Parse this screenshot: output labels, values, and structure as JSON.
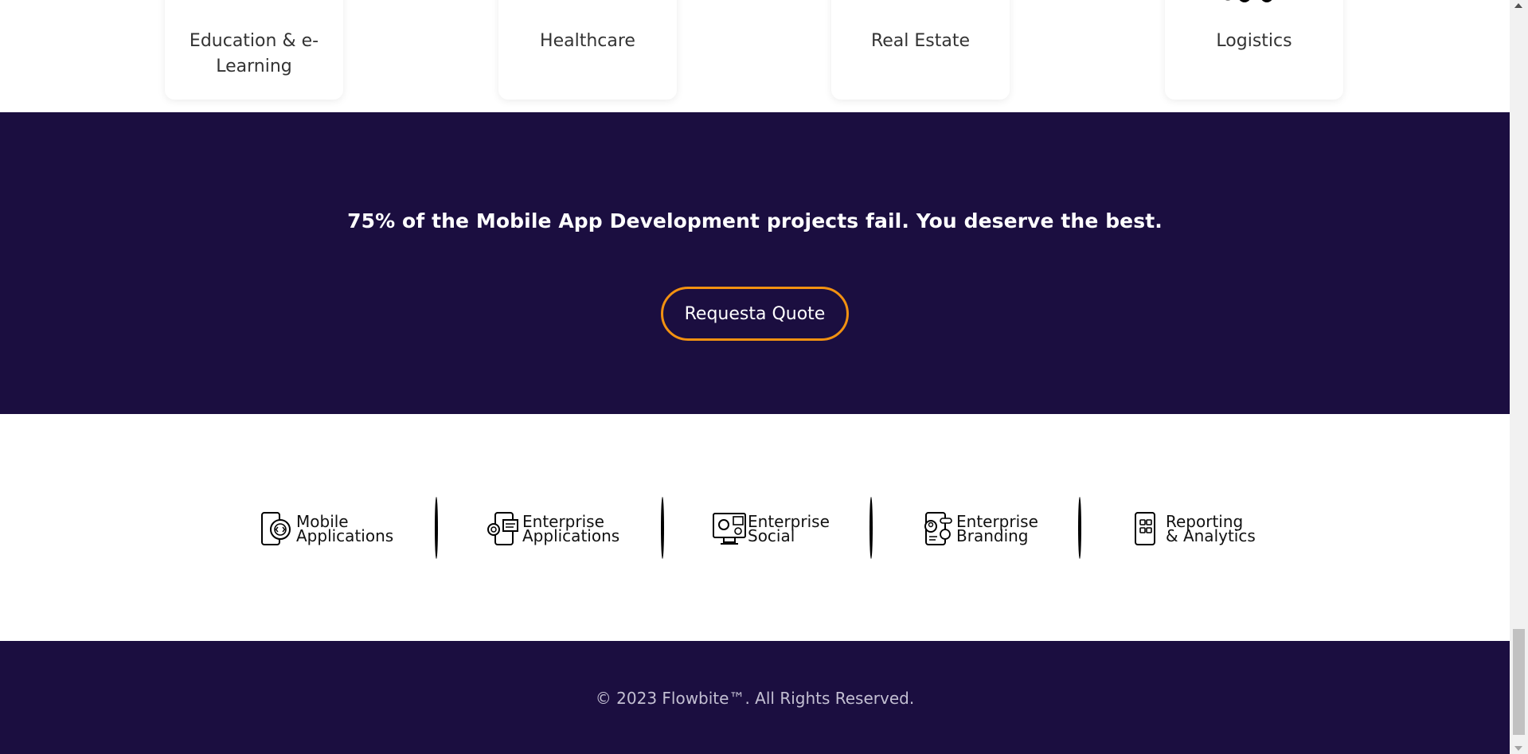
{
  "industries": [
    {
      "label": "Education & e-Learning",
      "icon": "education-icon"
    },
    {
      "label": "Healthcare",
      "icon": "healthcare-icon"
    },
    {
      "label": "Real Estate",
      "icon": "real-estate-icon"
    },
    {
      "label": "Logistics",
      "icon": "logistics-truck-icon"
    }
  ],
  "cta": {
    "heading": "75% of the Mobile App Development projects fail. You deserve the best.",
    "button_label": "Requesta Quote"
  },
  "services": [
    {
      "line1": "Mobile",
      "line2": "Applications",
      "icon": "mobile-code-gear-icon"
    },
    {
      "line1": "Enterprise",
      "line2": "Applications",
      "icon": "enterprise-apps-icon"
    },
    {
      "line1": "Enterprise",
      "line2": "Social",
      "icon": "enterprise-social-icon"
    },
    {
      "line1": "Enterprise",
      "line2": "Branding",
      "icon": "enterprise-branding-icon"
    },
    {
      "line1": "Reporting",
      "line2": "& Analytics",
      "icon": "reporting-analytics-icon"
    }
  ],
  "footer": {
    "copyright": "© 2023 Flowbite™. All Rights Reserved."
  },
  "colors": {
    "band": "#1b0e40",
    "accent": "#f29111"
  }
}
